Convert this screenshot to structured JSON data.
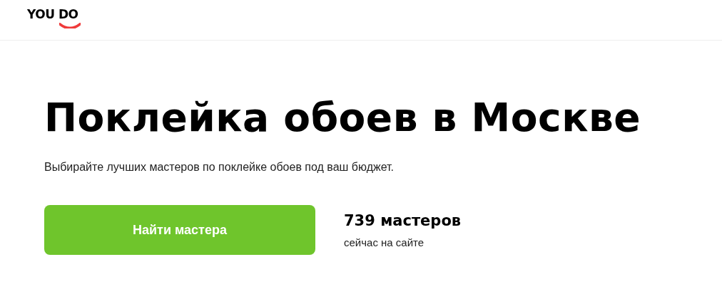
{
  "header": {
    "logo": "YOU DO"
  },
  "hero": {
    "title": "Поклейка обоев в Москве",
    "subtitle": "Выбирайте лучших мастеров по поклейке обоев под ваш бюджет.",
    "button": "Найти мастера",
    "stats": {
      "count": "739 мастеров",
      "caption": "сейчас на сайте"
    }
  }
}
